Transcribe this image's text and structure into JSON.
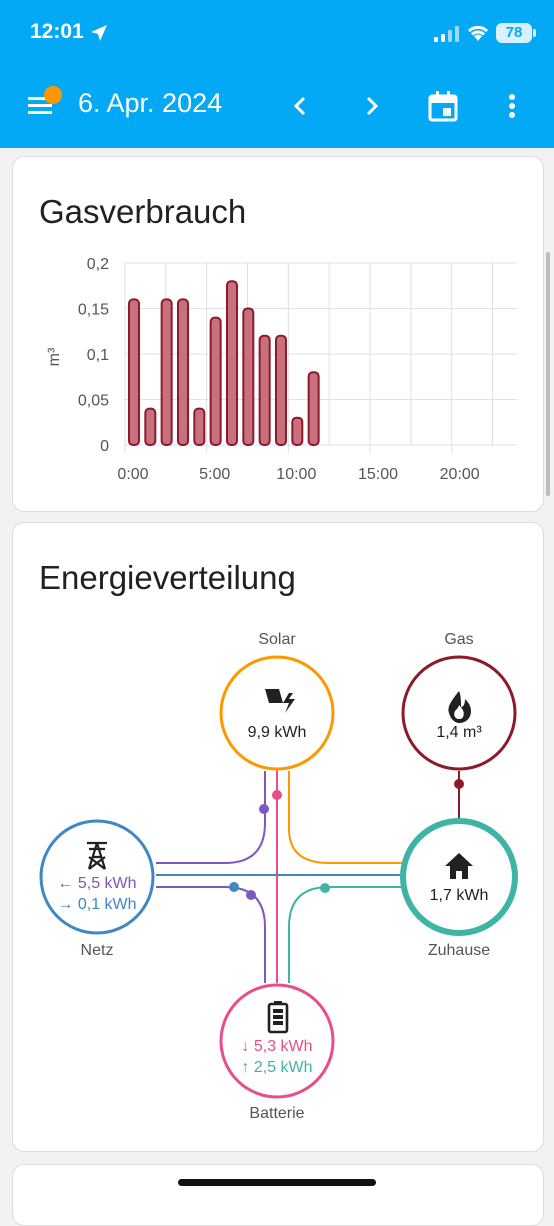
{
  "status_bar": {
    "time": "12:01",
    "battery": "78"
  },
  "header": {
    "title": "6. Apr. 2024"
  },
  "colors": {
    "accent": "#03a9f4",
    "gas": "#8b1a2b",
    "solar": "#ff9800",
    "grid": "#3f88c5",
    "home": "#3fb4a5",
    "battery": "#e94d8a",
    "purple": "#7e57c2"
  },
  "gas_card": {
    "title": "Gasverbrauch",
    "chart_data": {
      "type": "bar",
      "ylabel": "m³",
      "ylim": [
        0,
        0.2
      ],
      "yticks": [
        "0",
        "0,05",
        "0,1",
        "0,15",
        "0,2"
      ],
      "xticks": [
        "0:00",
        "5:00",
        "10:00",
        "15:00",
        "20:00"
      ],
      "hours": [
        0,
        1,
        2,
        3,
        4,
        5,
        6,
        7,
        8,
        9,
        10,
        11
      ],
      "values": [
        0.16,
        0.04,
        0.16,
        0.16,
        0.04,
        0.14,
        0.18,
        0.15,
        0.12,
        0.12,
        0.03,
        0.08
      ]
    }
  },
  "energy_card": {
    "title": "Energieverteilung",
    "solar": {
      "label": "Solar",
      "value": "9,9 kWh"
    },
    "gas": {
      "label": "Gas",
      "value": "1,4 m³"
    },
    "grid": {
      "label": "Netz",
      "value_in": "← 5,5 kWh",
      "value_out": "→ 0,1 kWh"
    },
    "home": {
      "label": "Zuhause",
      "value": "1,7 kWh"
    },
    "battery": {
      "label": "Batterie",
      "value_in": "↓ 5,3 kWh",
      "value_out": "↑ 2,5 kWh"
    }
  }
}
